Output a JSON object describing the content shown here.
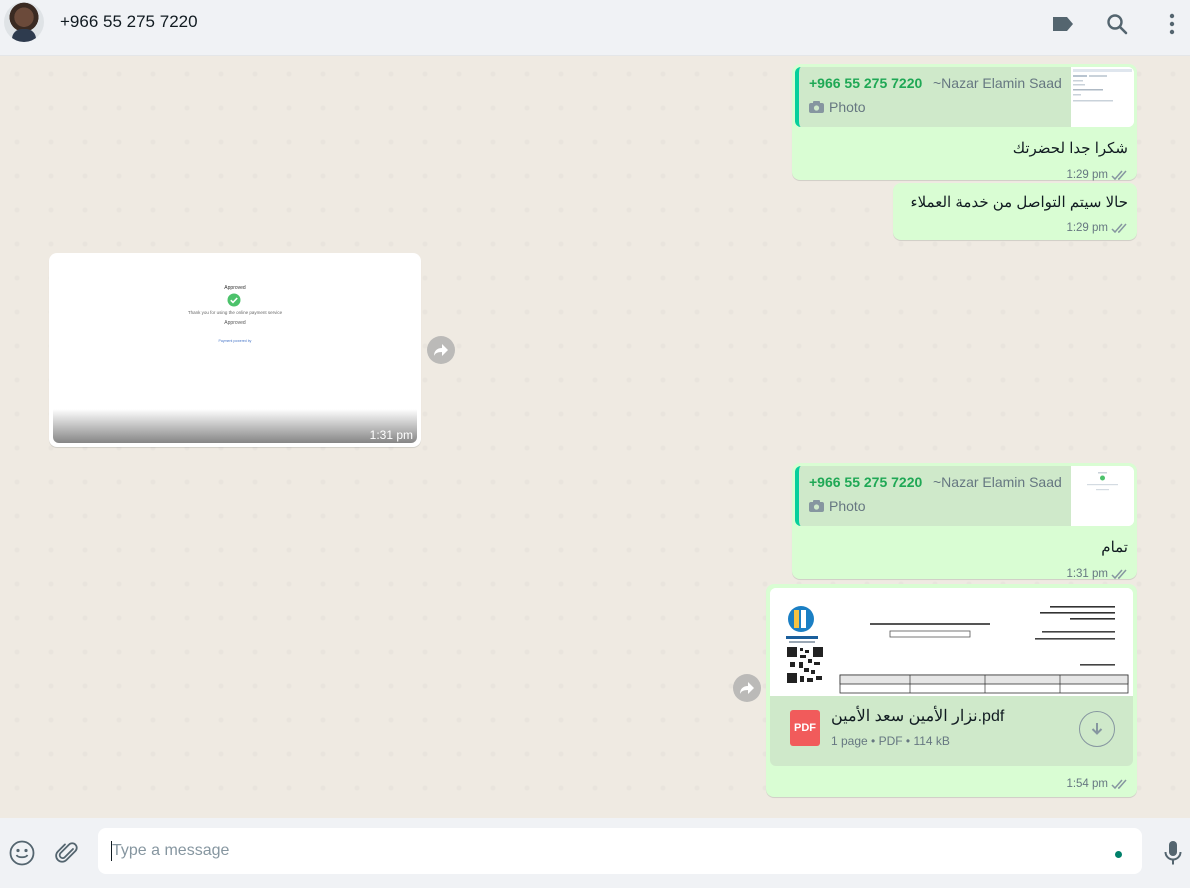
{
  "header": {
    "contact_name": "+966 55 275 7220",
    "icons": [
      "label-icon",
      "search-icon",
      "menu-icon"
    ]
  },
  "messages": [
    {
      "direction": "outgoing",
      "quote": {
        "sender": "+966 55 275 7220",
        "push_name": "~Nazar Elamin Saad",
        "type": "Photo"
      },
      "text": "شكرا جدا لحضرتك",
      "time": "1:29 pm"
    },
    {
      "direction": "outgoing",
      "text": "حالا سيتم التواصل من خدمة العملاء",
      "time": "1:29 pm"
    },
    {
      "direction": "incoming",
      "kind": "image",
      "preview": {
        "title": "Approved",
        "line": "Thank you for using the online payment service",
        "status": "Approved",
        "footer": "Payment powered by"
      },
      "time": "1:31 pm"
    },
    {
      "direction": "outgoing",
      "quote": {
        "sender": "+966 55 275 7220",
        "push_name": "~Nazar Elamin Saad",
        "type": "Photo"
      },
      "text": "تمام",
      "time": "1:31 pm"
    },
    {
      "direction": "outgoing",
      "kind": "document",
      "file_icon": "PDF",
      "file_name": "نزار الأمين سعد الأمين.pdf",
      "file_meta": "1 page • PDF • 114 kB",
      "time": "1:54 pm"
    }
  ],
  "composer": {
    "placeholder": "Type a message",
    "icons": [
      "emoji-icon",
      "attach-icon",
      "mic-icon"
    ]
  },
  "colors": {
    "outgoing_bubble": "#d9fdd3",
    "quote_accent": "#06cf9c",
    "quote_sender": "#1fa855",
    "chat_background": "#efeae2",
    "header_background": "#f0f2f5",
    "read_ticks": "#53bdeb"
  }
}
